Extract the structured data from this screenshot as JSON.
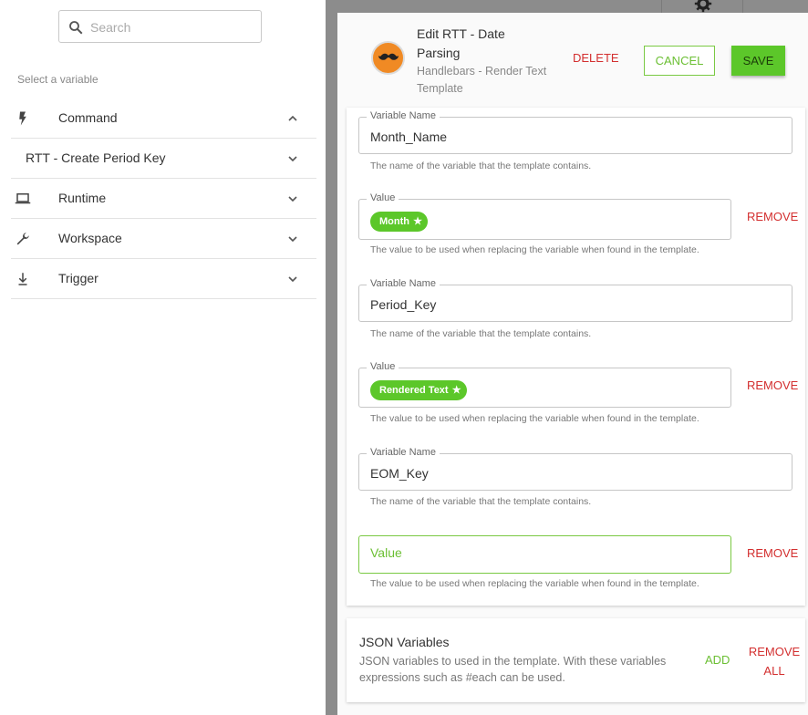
{
  "search": {
    "placeholder": "Search"
  },
  "sidebar": {
    "hint": "Select a variable",
    "items": [
      {
        "label": "Command",
        "icon": "lightning-icon",
        "chevron": "up"
      },
      {
        "label": "RTT - Create Period Key",
        "icon": "",
        "chevron": "down"
      },
      {
        "label": "Runtime",
        "icon": "laptop-icon",
        "chevron": "down"
      },
      {
        "label": "Workspace",
        "icon": "wrench-icon",
        "chevron": "down"
      },
      {
        "label": "Trigger",
        "icon": "trigger-icon",
        "chevron": "down"
      }
    ]
  },
  "modal": {
    "title": "Edit RTT - Date Parsing",
    "subtitle": "Handlebars - Render Text Template",
    "delete_label": "DELETE",
    "cancel_label": "CANCEL",
    "save_label": "SAVE"
  },
  "variables": [
    {
      "name_legend": "Variable Name",
      "name_value": "Month_Name",
      "name_helper": "The name of the variable that the template contains.",
      "value_legend": "Value",
      "value_chip": "Month",
      "value_helper": "The value to be used when replacing the variable when found in the template.",
      "remove_label": "REMOVE"
    },
    {
      "name_legend": "Variable Name",
      "name_value": "Period_Key",
      "name_helper": "The name of the variable that the template contains.",
      "value_legend": "Value",
      "value_chip": "Rendered Text",
      "value_helper": "The value to be used when replacing the variable when found in the template.",
      "remove_label": "REMOVE"
    },
    {
      "name_legend": "Variable Name",
      "name_value": "EOM_Key",
      "name_helper": "The name of the variable that the template contains.",
      "value_placeholder": "Value",
      "value_helper": "The value to be used when replacing the variable when found in the template.",
      "remove_label": "REMOVE"
    }
  ],
  "json_variables": {
    "title": "JSON Variables",
    "description": "JSON variables to used in the template. With these variables expressions such as #each can be used.",
    "add_label": "ADD",
    "remove_all_label": "REMOVE ALL"
  },
  "colors": {
    "accent_green": "#5cc72a",
    "danger_red": "#d32f2f",
    "avatar_orange": "#f08a24"
  }
}
